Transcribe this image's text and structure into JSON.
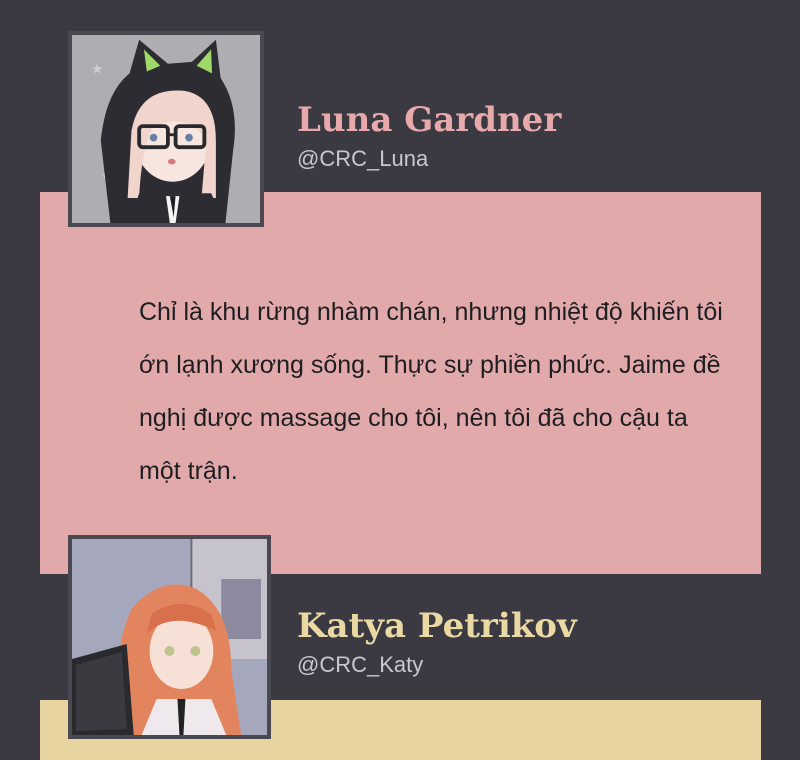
{
  "posts": [
    {
      "name": "Luna Gardner",
      "handle": "@CRC_Luna",
      "message": "Chỉ là khu rừng nhàm chán, nhưng nhiệt độ khiến tôi ớn lạnh xương sống. Thực sự phiền phức. Jaime đề nghị được massage cho tôi, nên tôi đã cho cậu ta một trận.",
      "name_color": "#e8a9ab",
      "card_color": "#e1a9aa"
    },
    {
      "name": "Katya Petrikov",
      "handle": "@CRC_Katy",
      "name_color": "#ead9a2",
      "card_color": "#e7d4a0"
    }
  ]
}
